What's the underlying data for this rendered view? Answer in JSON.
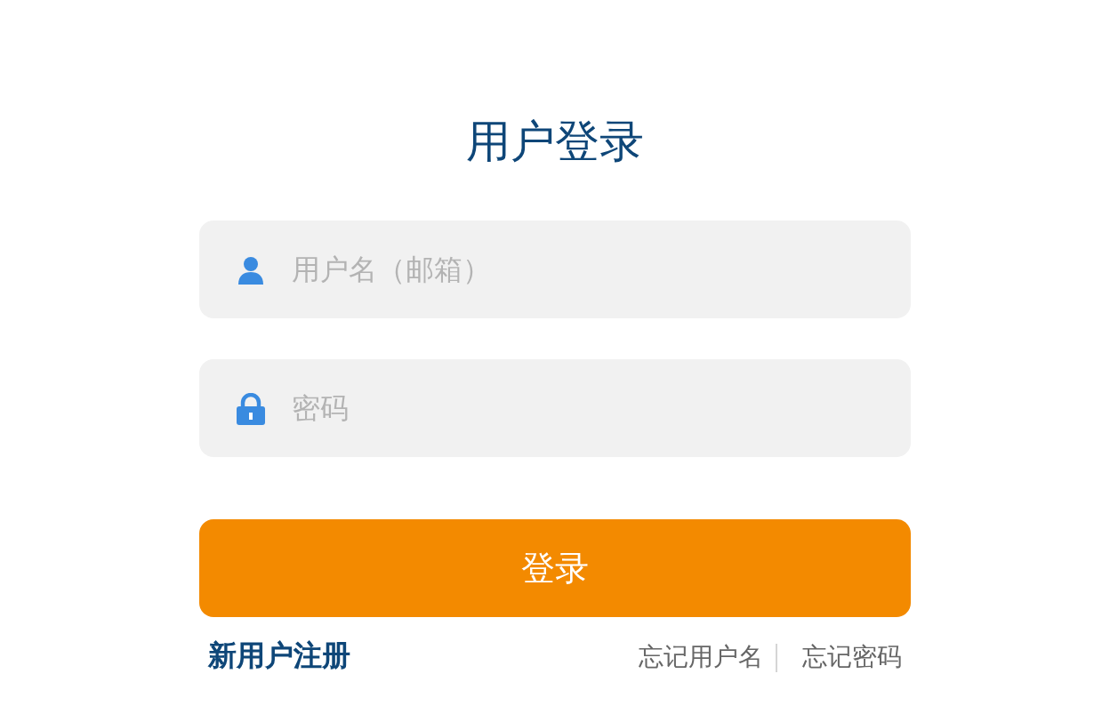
{
  "title": "用户登录",
  "fields": [
    {
      "kind": "user",
      "placeholder": "用户名（邮箱）"
    },
    {
      "kind": "password",
      "placeholder": "密码"
    }
  ],
  "submit": "登录",
  "register_link": "新用户注册",
  "help_links": [
    "忘记用户名",
    "忘记密码"
  ]
}
